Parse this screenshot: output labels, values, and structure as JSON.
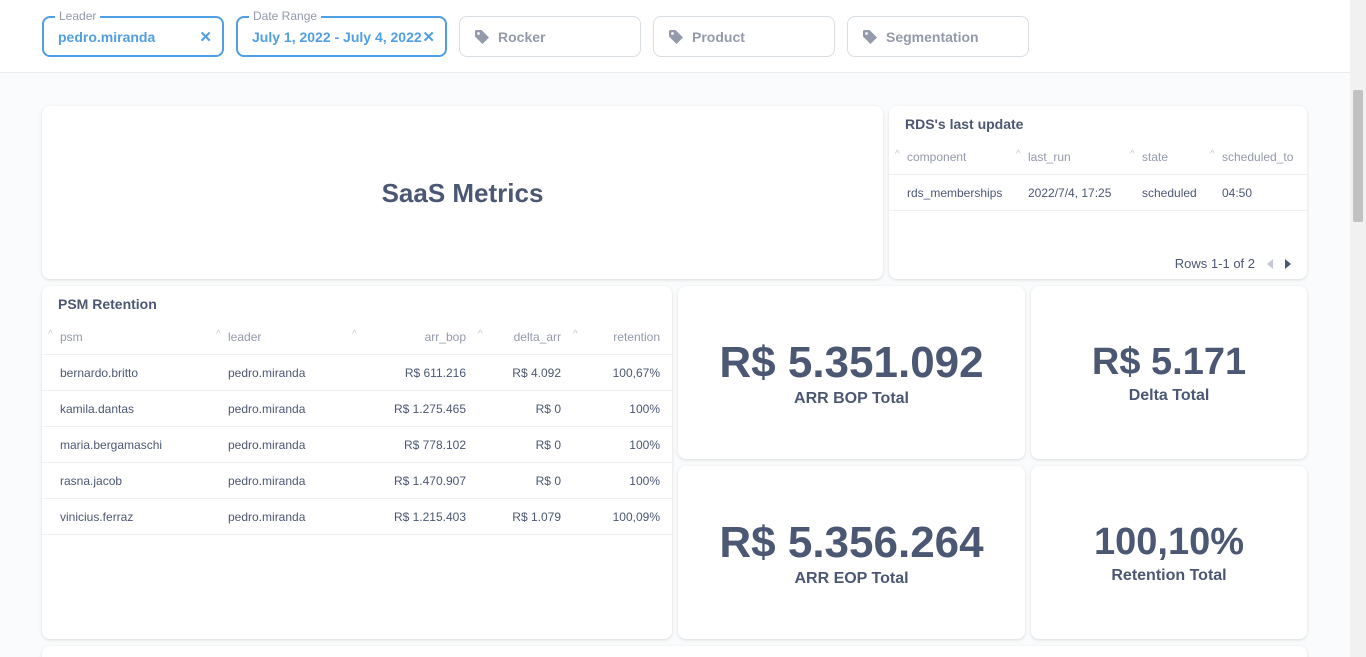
{
  "filters": [
    {
      "label": "Leader",
      "value": "pedro.miranda",
      "active": true
    },
    {
      "label": "Date Range",
      "value": "July 1, 2022 - July 4, 2022",
      "active": true
    },
    {
      "label": "",
      "value": "Rocker",
      "active": false,
      "icon": "tag-icon"
    },
    {
      "label": "",
      "value": "Product",
      "active": false,
      "icon": "tag-icon"
    },
    {
      "label": "",
      "value": "Segmentation",
      "active": false,
      "icon": "tag-icon"
    }
  ],
  "clear_symbol": "✕",
  "saas": {
    "title": "SaaS Metrics"
  },
  "rds": {
    "title": "RDS's last update",
    "columns": [
      "component",
      "last_run",
      "state",
      "scheduled_to"
    ],
    "rows": [
      [
        "rds_memberships",
        "2022/7/4, 17:25",
        "scheduled",
        "04:50"
      ]
    ],
    "pager": "Rows 1-1 of 2"
  },
  "psm": {
    "title": "PSM Retention",
    "columns": [
      "psm",
      "leader",
      "arr_bop",
      "delta_arr",
      "retention"
    ],
    "rows": [
      [
        "bernardo.britto",
        "pedro.miranda",
        "R$ 611.216",
        "R$ 4.092",
        "100,67%"
      ],
      [
        "kamila.dantas",
        "pedro.miranda",
        "R$ 1.275.465",
        "R$ 0",
        "100%"
      ],
      [
        "maria.bergamaschi",
        "pedro.miranda",
        "R$ 778.102",
        "R$ 0",
        "100%"
      ],
      [
        "rasna.jacob",
        "pedro.miranda",
        "R$ 1.470.907",
        "R$ 0",
        "100%"
      ],
      [
        "vinicius.ferraz",
        "pedro.miranda",
        "R$ 1.215.403",
        "R$ 1.079",
        "100,09%"
      ]
    ]
  },
  "scalars": {
    "arr_bop": {
      "value": "R$ 5.351.092",
      "label": "ARR BOP Total"
    },
    "delta": {
      "value": "R$ 5.171",
      "label": "Delta Total"
    },
    "arr_eop": {
      "value": "R$ 5.356.264",
      "label": "ARR EOP Total"
    },
    "retention": {
      "value": "100,10%",
      "label": "Retention Total"
    }
  },
  "colors": {
    "accent": "#509ee3",
    "text": "#4c5773",
    "muted": "#949aab"
  }
}
